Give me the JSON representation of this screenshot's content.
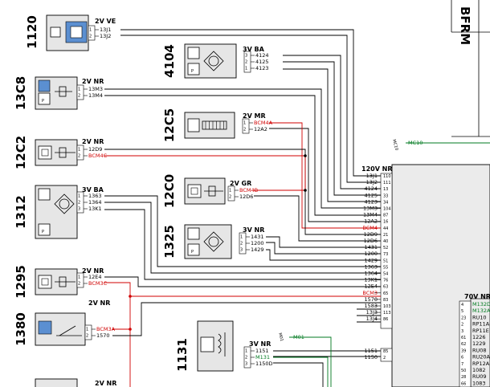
{
  "title_block": {
    "label": "BFRM"
  },
  "components": [
    {
      "id": "1120",
      "connector": "2V VE",
      "wires": [
        "13J1",
        "13J2"
      ],
      "pins": [
        "1",
        "2"
      ]
    },
    {
      "id": "4104",
      "connector": "3V BA",
      "wires": [
        "4124",
        "4125",
        "4123"
      ],
      "pins": [
        "3",
        "2",
        "1"
      ]
    },
    {
      "id": "13C8",
      "connector": "2V NR",
      "wires": [
        "13M3",
        "13M4"
      ],
      "pins": [
        "1",
        "2"
      ]
    },
    {
      "id": "12C5",
      "connector": "2V MR",
      "wires": [
        "BCM4A",
        "12A2"
      ],
      "pins": [
        "1",
        "2"
      ]
    },
    {
      "id": "12C2",
      "connector": "2V NR",
      "wires": [
        "12D9",
        "BCM4C"
      ],
      "pins": [
        "1",
        "2"
      ]
    },
    {
      "id": "12C0",
      "connector": "2V GR",
      "wires": [
        "BCM4B",
        "12D6"
      ],
      "pins": [
        "1",
        "2"
      ]
    },
    {
      "id": "1312",
      "connector": "3V BA",
      "wires": [
        "1363",
        "1364",
        "13K1"
      ],
      "pins": [
        "1",
        "2",
        "3"
      ]
    },
    {
      "id": "1325",
      "connector": "3V NR",
      "wires": [
        "1431",
        "1200",
        "1429"
      ],
      "pins": [
        "1",
        "2",
        "3"
      ]
    },
    {
      "id": "1295",
      "connector": "2V NR",
      "wires": [
        "12E4",
        "BCM3C"
      ],
      "pins": [
        "1",
        "2"
      ]
    },
    {
      "id": "1380",
      "connector": "2V NR",
      "wires": [
        "BCM3A",
        "1570"
      ],
      "pins": [
        "1",
        "2"
      ]
    },
    {
      "id": "1131",
      "connector": "3V NR",
      "wires": [
        "1151",
        "M131",
        "1150D"
      ],
      "pins": [
        "1",
        "2",
        "3"
      ]
    },
    {
      "id": "",
      "connector": "2V NR",
      "wires": [],
      "pins": []
    }
  ],
  "ecu_main": {
    "connector": "120V NR",
    "rows": [
      {
        "wire": "13J1",
        "pin": "110"
      },
      {
        "wire": "13J2",
        "pin": "111"
      },
      {
        "wire": "4124",
        "pin": "13"
      },
      {
        "wire": "4125",
        "pin": "33"
      },
      {
        "wire": "4123",
        "pin": "34"
      },
      {
        "wire": "13M3",
        "pin": "104"
      },
      {
        "wire": "13M4",
        "pin": "87"
      },
      {
        "wire": "12A2",
        "pin": "16"
      },
      {
        "wire": "BCM4",
        "pin": "44"
      },
      {
        "wire": "12D9",
        "pin": "21"
      },
      {
        "wire": "12D6",
        "pin": "40"
      },
      {
        "wire": "1431",
        "pin": "52"
      },
      {
        "wire": "1200",
        "pin": "73"
      },
      {
        "wire": "1429",
        "pin": "51"
      },
      {
        "wire": "1363",
        "pin": "55"
      },
      {
        "wire": "1364",
        "pin": "54"
      },
      {
        "wire": "13K1",
        "pin": "76"
      },
      {
        "wire": "12E4",
        "pin": "63"
      },
      {
        "wire": "BCM3",
        "pin": "65"
      },
      {
        "wire": "1570",
        "pin": "83"
      },
      {
        "wire": "1583",
        "pin": "103"
      },
      {
        "wire": "13J3",
        "pin": "113"
      },
      {
        "wire": "13J4",
        "pin": "86"
      }
    ],
    "extra_rows": [
      {
        "wire": "1151",
        "pin": "85"
      },
      {
        "wire": "1150",
        "pin": "2"
      }
    ]
  },
  "ecu_second": {
    "connector": "70V NR",
    "rows": [
      {
        "wire": "M132D",
        "pin": "4"
      },
      {
        "wire": "M132A",
        "pin": "5"
      },
      {
        "wire": "RU10",
        "pin": "23"
      },
      {
        "wire": "RP11A",
        "pin": "2"
      },
      {
        "wire": "RP11E",
        "pin": "3"
      },
      {
        "wire": "1226",
        "pin": "61"
      },
      {
        "wire": "1229",
        "pin": "62"
      },
      {
        "wire": "RU08",
        "pin": "39"
      },
      {
        "wire": "RU20A",
        "pin": "6"
      },
      {
        "wire": "RP12A",
        "pin": "7"
      },
      {
        "wire": "1082",
        "pin": "50"
      },
      {
        "wire": "RU09",
        "pin": "28"
      },
      {
        "wire": "1083",
        "pin": "66"
      }
    ]
  },
  "ground_nets": [
    {
      "label": "MC10",
      "wire": "MC10"
    },
    {
      "label": "M01",
      "wire": "M01"
    }
  ],
  "colors": {
    "wire": "#000000",
    "bcm_wire": "#d00000",
    "ground_wire": "#007a20",
    "box_fill": "#e6e6e6"
  }
}
